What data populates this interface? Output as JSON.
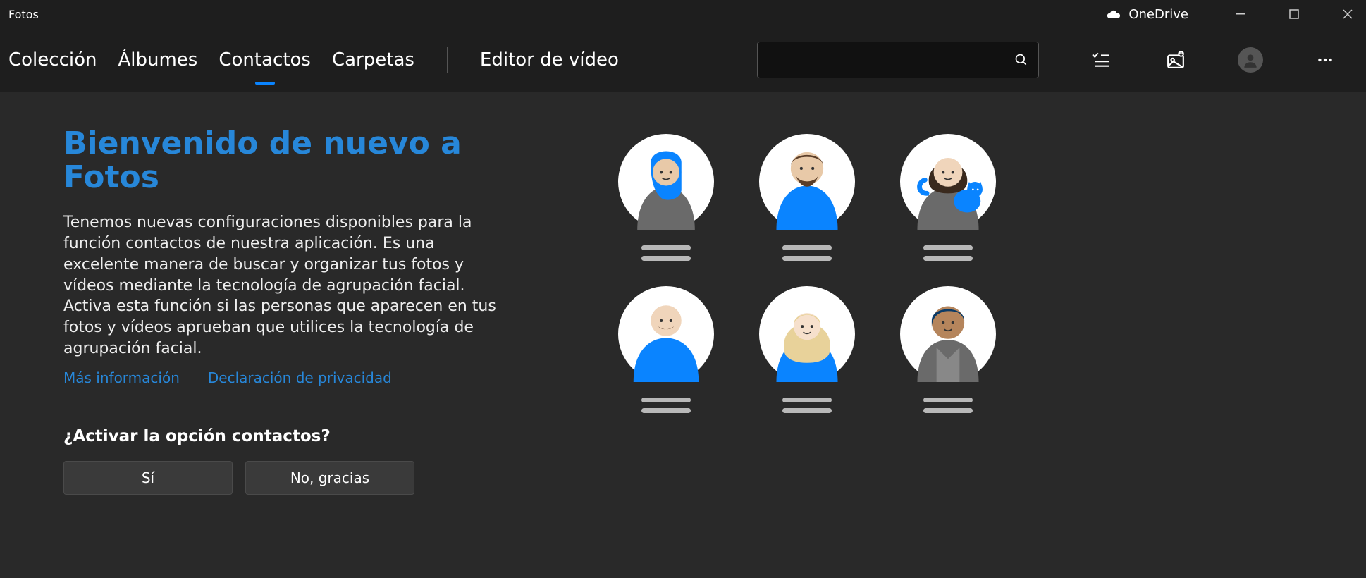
{
  "titlebar": {
    "app_name": "Fotos",
    "onedrive_label": "OneDrive"
  },
  "nav": {
    "tabs": [
      "Colección",
      "Álbumes",
      "Contactos",
      "Carpetas",
      "Editor de vídeo"
    ],
    "active_index": 2,
    "search_placeholder": ""
  },
  "main": {
    "headline": "Bienvenido de nuevo a Fotos",
    "paragraph1": "Tenemos nuevas configuraciones disponibles para la función contactos de nuestra aplicación. Es una excelente manera de buscar y organizar tus fotos y vídeos mediante la tecnología de agrupación facial.",
    "paragraph2": "Activa esta función si las personas que aparecen en tus fotos y vídeos aprueban que utilices la tecnología de agrupación facial.",
    "link_more_info": "Más información",
    "link_privacy": "Declaración de privacidad",
    "question": "¿Activar la opción contactos?",
    "btn_yes": "Sí",
    "btn_no": "No, gracias"
  }
}
